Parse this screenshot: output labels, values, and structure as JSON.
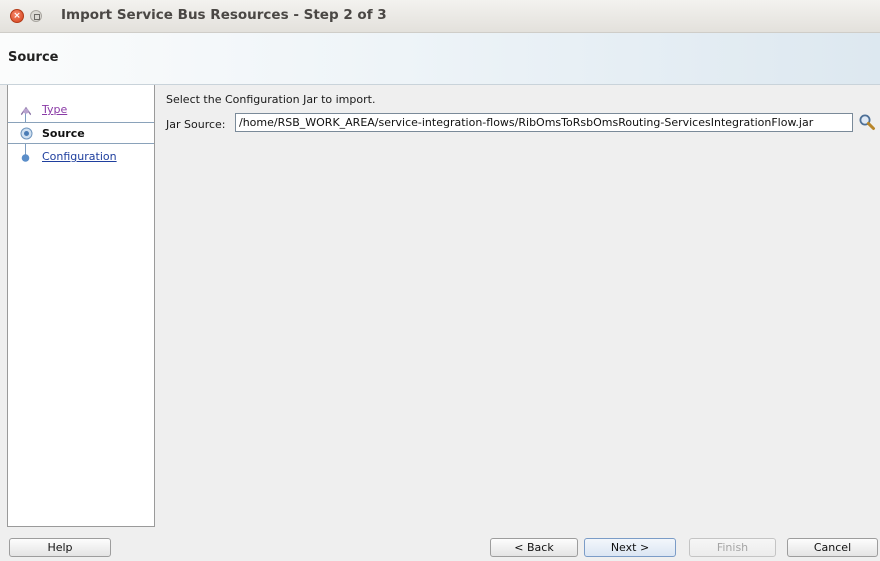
{
  "window": {
    "title": "Import Service Bus Resources - Step 2 of 3"
  },
  "header": {
    "title": "Source"
  },
  "steps": [
    {
      "label": "Type",
      "state": "visited"
    },
    {
      "label": "Source",
      "state": "current"
    },
    {
      "label": "Configuration",
      "state": "upcoming"
    }
  ],
  "main": {
    "instruction": "Select the Configuration Jar to import.",
    "jar_label": "Jar Source:",
    "jar_value": "/home/RSB_WORK_AREA/service-integration-flows/RibOmsToRsbOmsRouting-ServicesIntegrationFlow.jar"
  },
  "buttons": {
    "help": "Help",
    "back": "< Back",
    "next": "Next >",
    "finish": "Finish",
    "cancel": "Cancel"
  },
  "icons": {
    "browse": "search-icon"
  },
  "colors": {
    "link_visited": "#8a3aa6",
    "link": "#1f3f9e",
    "close_button": "#d4421a"
  }
}
